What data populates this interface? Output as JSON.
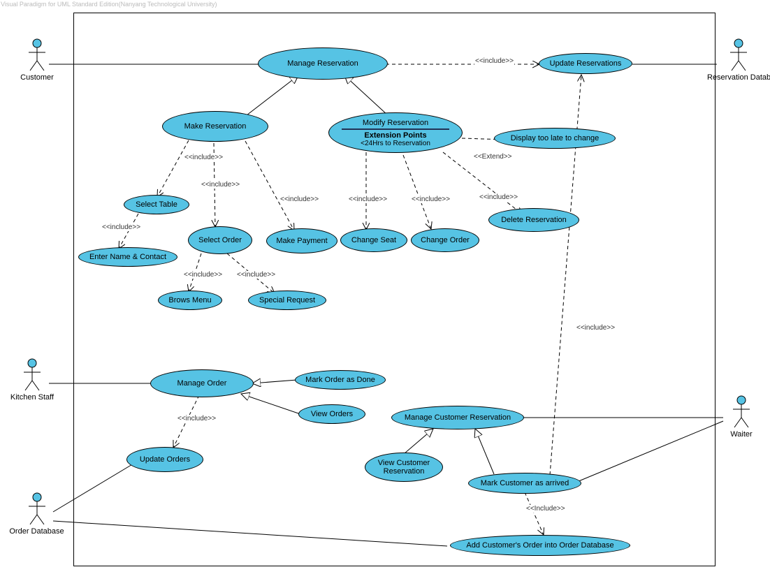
{
  "watermark": "Visual Paradigm for UML Standard Edition(Nanyang Technological University)",
  "actors": {
    "customer": "Customer",
    "resdb": "Reservation Database",
    "kitchen": "Kitchen Staff",
    "orderdb": "Order Database",
    "waiter": "Waiter"
  },
  "include": "<<include>>",
  "includeCap": "<<Include>>",
  "extend": "<<Extend>>",
  "usecases": {
    "manage_reservation": "Manage Reservation",
    "update_reservations": "Update Reservations",
    "make_reservation": "Make Reservation",
    "modify_reservation": "Modify Reservation",
    "modify_ext_title": "Extension Points",
    "modify_ext_sub": "<24Hrs to Reservation",
    "display_too_late": "Display too late to change",
    "select_table": "Select Table",
    "enter_name": "Enter Name & Contact",
    "select_order": "Select Order",
    "make_payment": "Make Payment",
    "change_seat": "Change Seat",
    "change_order": "Change Order",
    "delete_reservation": "Delete Reservation",
    "browse_menu": "Brows Menu",
    "special_request": "Special Request",
    "manage_order": "Manage Order",
    "mark_done": "Mark Order as Done",
    "view_orders": "View Orders",
    "update_orders": "Update Orders",
    "manage_cust_res": "Manage Customer Reservation",
    "view_cust_res": "View Customer Reservation",
    "mark_arrived": "Mark Customer as arrived",
    "add_to_db": "Add Customer's Order into Order Database"
  }
}
